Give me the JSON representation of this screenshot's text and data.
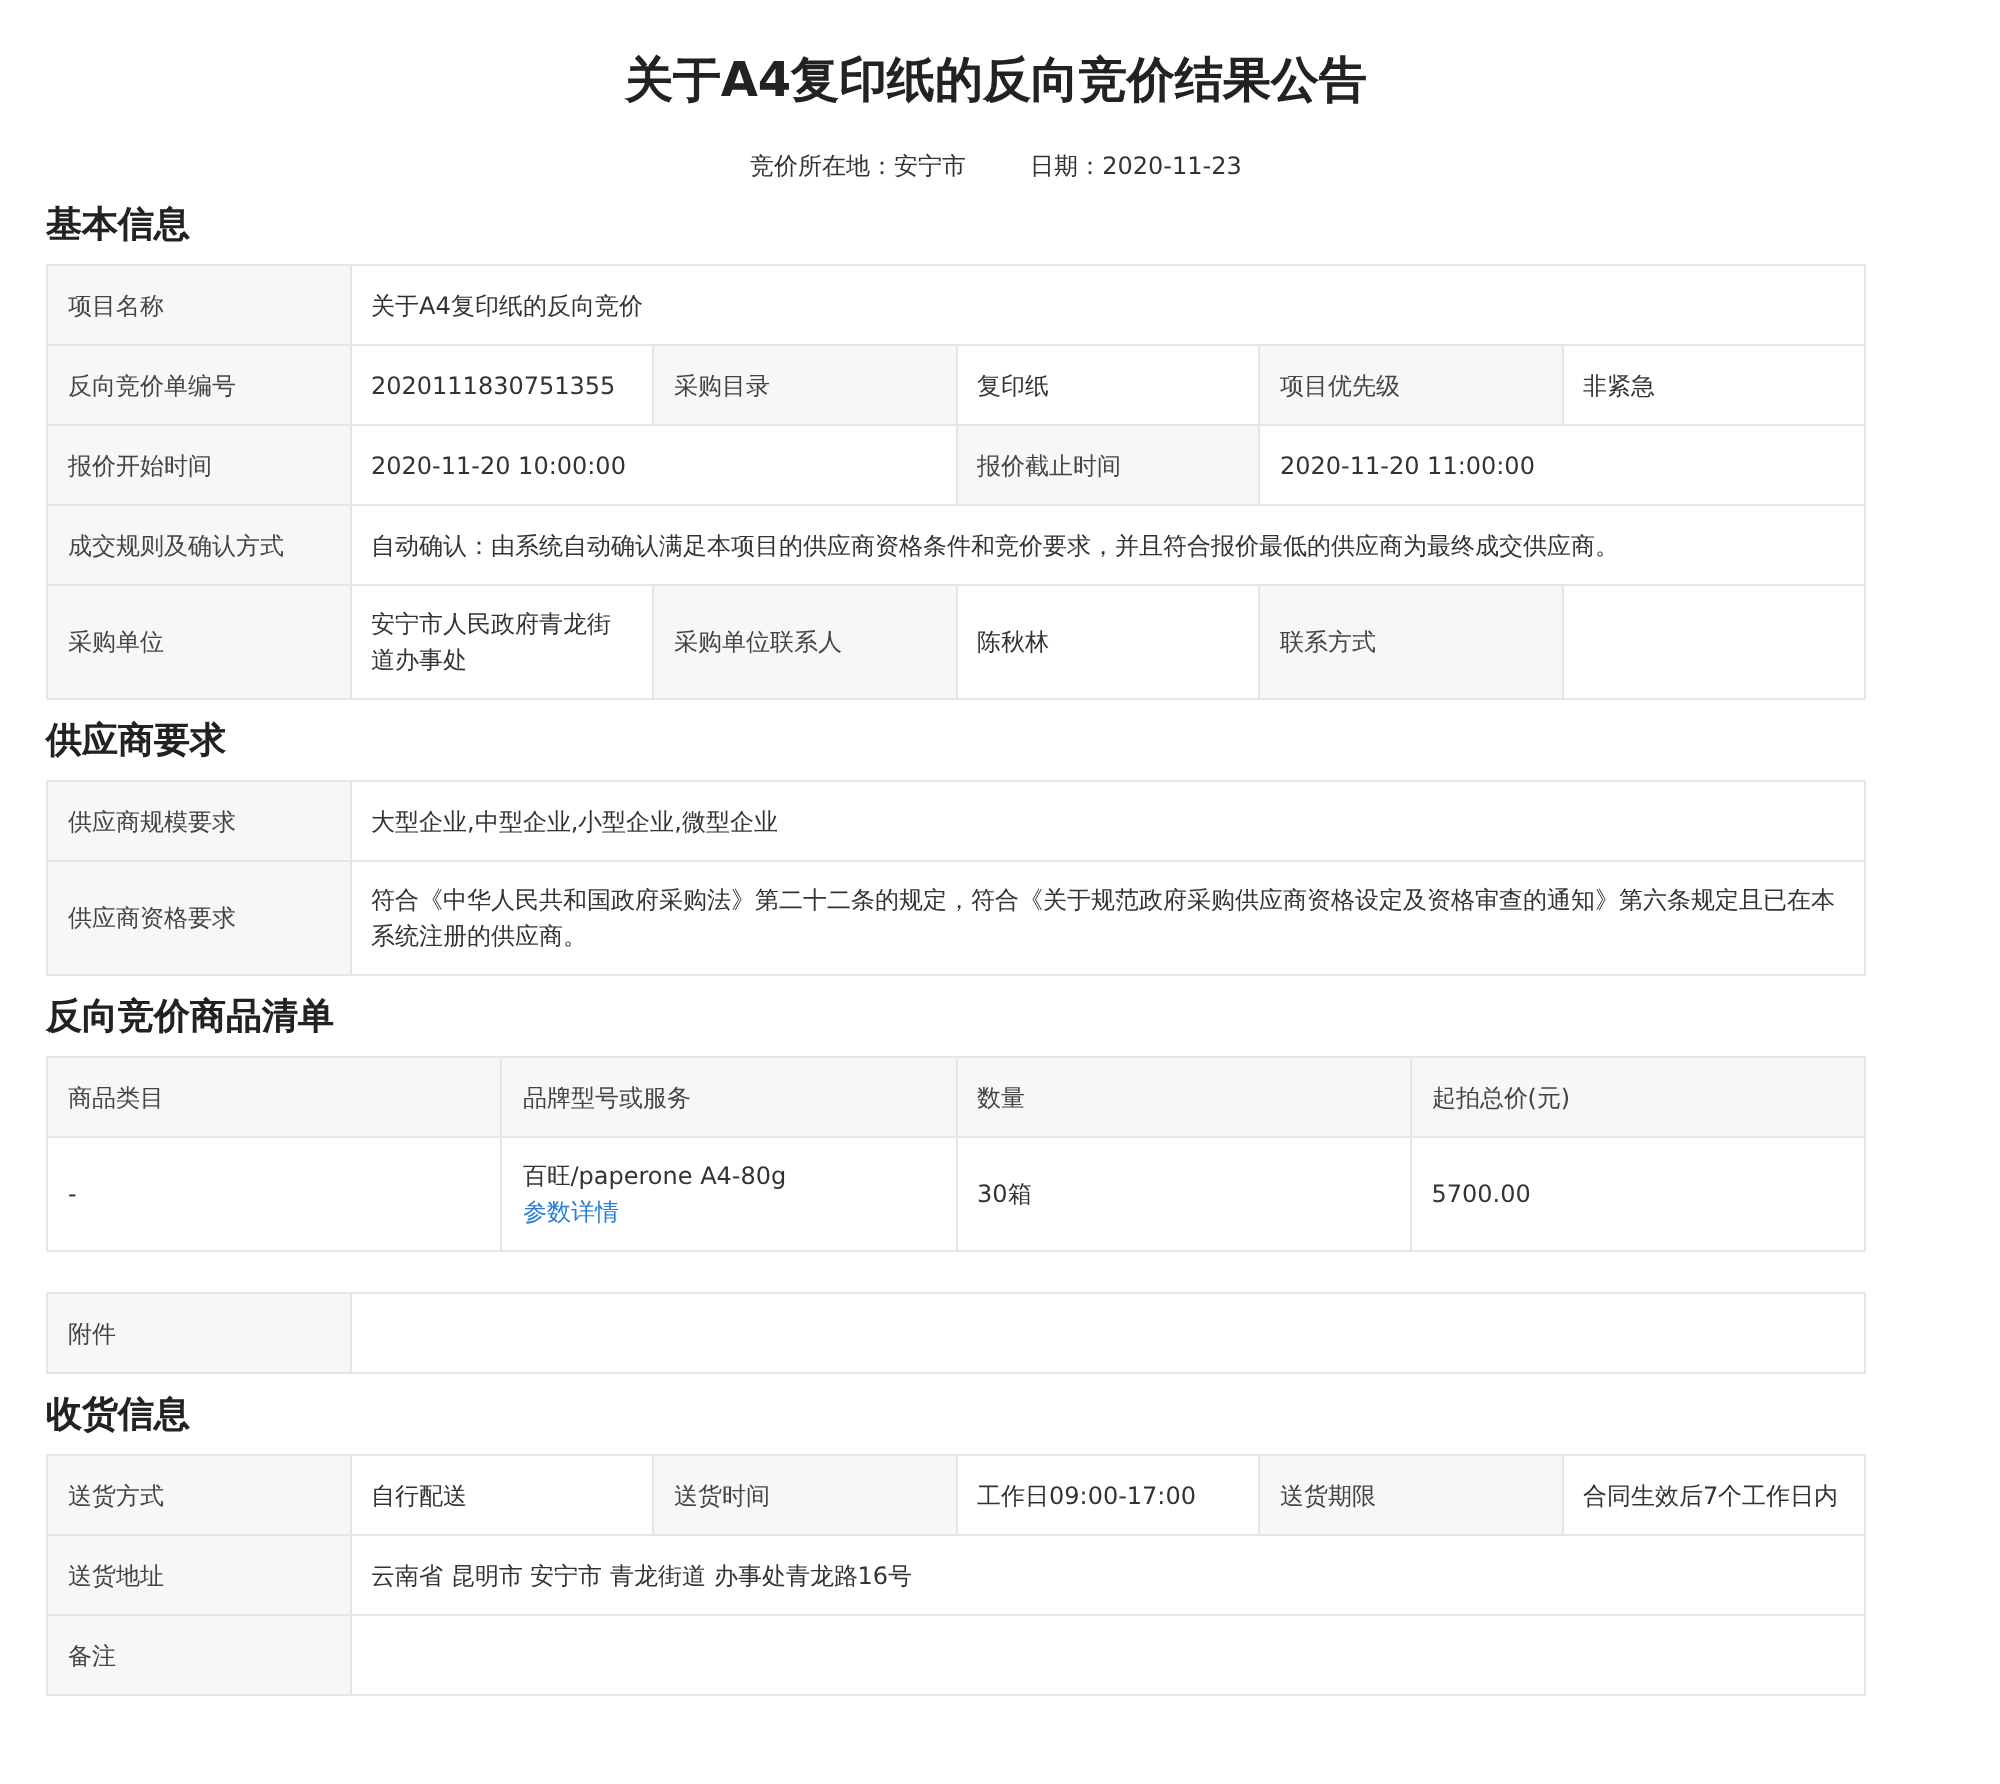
{
  "title": "关于A4复印纸的反向竞价结果公告",
  "meta": [
    "竞价所在地：安宁市",
    "日期：2020-11-23"
  ],
  "sections": [
    {
      "kind": "grid",
      "heading": "基本信息",
      "rows": [
        [
          {
            "kind": "label",
            "text": "项目名称"
          },
          {
            "kind": "value",
            "text": "关于A4复印纸的反向竞价"
          },
          "",
          "",
          "",
          ""
        ],
        [
          {
            "kind": "label",
            "text": "反向竞价单编号"
          },
          {
            "kind": "value",
            "text": "2020111830751355"
          },
          {
            "kind": "label",
            "text": "采购目录"
          },
          {
            "kind": "value",
            "text": "复印纸"
          },
          {
            "kind": "label",
            "text": "项目优先级"
          },
          {
            "kind": "value",
            "text": "非紧急"
          }
        ],
        [
          {
            "kind": "label",
            "text": "报价开始时间"
          },
          {
            "kind": "value",
            "text": "2020-11-20 10:00:00"
          },
          "",
          {
            "kind": "label",
            "text": "报价截止时间"
          },
          {
            "kind": "value",
            "text": "2020-11-20 11:00:00"
          },
          ""
        ],
        [
          {
            "kind": "label",
            "text": "成交规则及确认方式"
          },
          {
            "kind": "value",
            "text": "自动确认：由系统自动确认满足本项目的供应商资格条件和竞价要求，并且符合报价最低的供应商为最终成交供应商。"
          },
          "",
          "",
          "",
          ""
        ],
        [
          {
            "kind": "label",
            "text": "采购单位"
          },
          {
            "kind": "value",
            "text": "安宁市人民政府青龙街道办事处"
          },
          {
            "kind": "label",
            "text": "采购单位联系人"
          },
          {
            "kind": "value",
            "text": "陈秋林"
          },
          {
            "kind": "label",
            "text": "联系方式"
          },
          {
            "kind": "value"
          }
        ]
      ]
    },
    {
      "kind": "grid",
      "heading": "供应商要求",
      "rows": [
        [
          {
            "kind": "label",
            "text": "供应商规模要求"
          },
          {
            "kind": "value",
            "text": "大型企业,中型企业,小型企业,微型企业"
          },
          "",
          "",
          "",
          ""
        ],
        [
          {
            "kind": "label",
            "text": "供应商资格要求"
          },
          {
            "kind": "value",
            "text": "符合《中华人民共和国政府采购法》第二十二条的规定，符合《关于规范政府采购供应商资格设定及资格审查的通知》第六条规定且已在本系统注册的供应商。"
          },
          "",
          "",
          "",
          ""
        ]
      ]
    },
    {
      "kind": "items",
      "heading": "反向竞价商品清单",
      "columns": [
        "商品类目",
        "品牌型号或服务",
        "数量",
        "起拍总价(元)"
      ],
      "rows": [
        {
          "category": "-",
          "brand": "百旺/paperone A4-80g",
          "link": "参数详情",
          "quantity": "30箱",
          "price": "5700.00"
        }
      ]
    },
    {
      "kind": "grid",
      "rows": [
        [
          {
            "kind": "label",
            "text": "附件"
          },
          {
            "kind": "value"
          },
          "",
          "",
          "",
          ""
        ]
      ]
    },
    {
      "kind": "grid",
      "heading": "收货信息",
      "rows": [
        [
          {
            "kind": "label",
            "text": "送货方式"
          },
          {
            "kind": "value",
            "text": "自行配送"
          },
          {
            "kind": "label",
            "text": "送货时间"
          },
          {
            "kind": "value",
            "text": "工作日09:00-17:00"
          },
          {
            "kind": "label",
            "text": "送货期限"
          },
          {
            "kind": "value",
            "text": "合同生效后7个工作日内"
          }
        ],
        [
          {
            "kind": "label",
            "text": "送货地址"
          },
          {
            "kind": "value",
            "text": "云南省 昆明市 安宁市 青龙街道 办事处青龙路16号"
          },
          "",
          "",
          "",
          ""
        ],
        [
          {
            "kind": "label",
            "text": "备注"
          },
          {
            "kind": "value"
          },
          "",
          "",
          "",
          ""
        ]
      ]
    }
  ]
}
